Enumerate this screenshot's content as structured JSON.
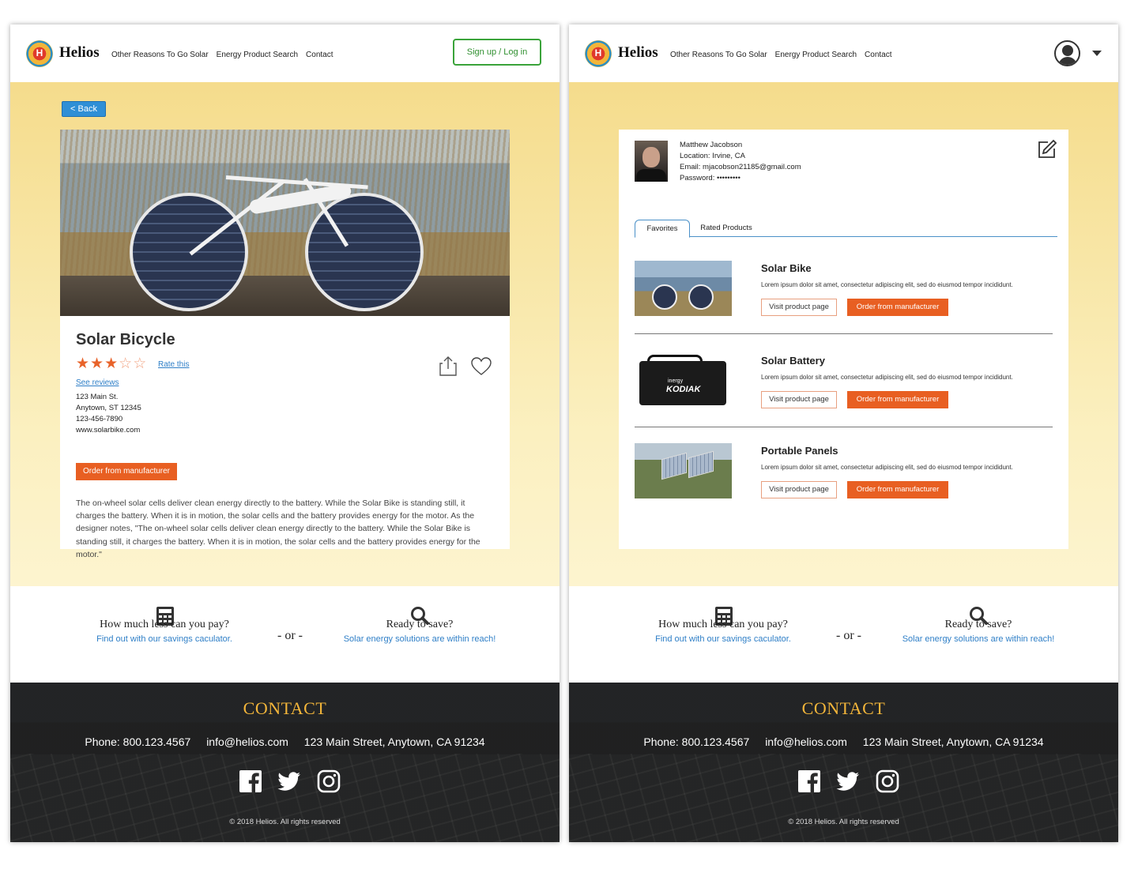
{
  "header": {
    "brand": "Helios",
    "logo_letter": "H",
    "nav": [
      "Other Reasons To Go Solar",
      "Energy Product Search",
      "Contact"
    ],
    "signup_label": "Sign up / Log in"
  },
  "left": {
    "back_label": "< Back",
    "product": {
      "title": "Solar Bicycle",
      "rating": 3,
      "rating_max": 5,
      "rate_this": "Rate this",
      "see_reviews": "See reviews",
      "address_line1": "123 Main St.",
      "address_line2": "Anytown, ST 12345",
      "phone": "123-456-7890",
      "website": "www.solarbike.com",
      "order_label": "Order from manufacturer",
      "description": "The on-wheel solar cells deliver clean energy directly to the battery. While the Solar Bike is standing still, it charges the battery. When it is in motion, the solar cells and the battery provides energy for the motor. As the designer notes, \"The on-wheel solar cells deliver clean energy directly to the battery. While the Solar Bike is standing still, it charges the battery. When it is in motion, the solar cells and the battery provides energy for the motor.\""
    }
  },
  "right": {
    "profile": {
      "name": "Matthew Jacobson",
      "location": "Location: Irvine, CA",
      "email": "Email: mjacobson21185@gmail.com",
      "password": "Password: •••••••••"
    },
    "tabs": [
      "Favorites",
      "Rated Products"
    ],
    "items": [
      {
        "name": "Solar Bike",
        "text": "Lorem ipsum dolor sit amet, consectetur adipiscing elit, sed do eiusmod tempor incididunt.",
        "visit": "Visit product page",
        "order": "Order from manufacturer"
      },
      {
        "name": "Solar Battery",
        "text": "Lorem ipsum dolor sit amet, consectetur adipiscing elit, sed do eiusmod tempor incididunt.",
        "visit": "Visit product page",
        "order": "Order from manufacturer",
        "image_brand": "inergy",
        "image_model": "KODIAK"
      },
      {
        "name": "Portable Panels",
        "text": "Lorem ipsum dolor sit amet, consectetur adipiscing elit, sed do eiusmod tempor incididunt.",
        "visit": "Visit product page",
        "order": "Order from manufacturer"
      }
    ]
  },
  "promo": {
    "calc_question": "How much less can you pay?",
    "calc_link": "Find out with our savings caculator.",
    "or": "- or -",
    "save_question": "Ready to save?",
    "save_link": "Solar energy solutions are within reach!"
  },
  "footer": {
    "title": "CONTACT",
    "phone": "Phone: 800.123.4567",
    "email": "info@helios.com",
    "address": "123 Main Street, Anytown, CA 91234",
    "copyright": "© 2018 Helios. All rights reserved",
    "social": [
      "facebook-icon",
      "twitter-icon",
      "instagram-icon"
    ]
  },
  "colors": {
    "accent_orange": "#e85f22",
    "link_blue": "#2f7fc7",
    "signup_green": "#3aa33a",
    "footer_gold": "#f2b53a"
  }
}
